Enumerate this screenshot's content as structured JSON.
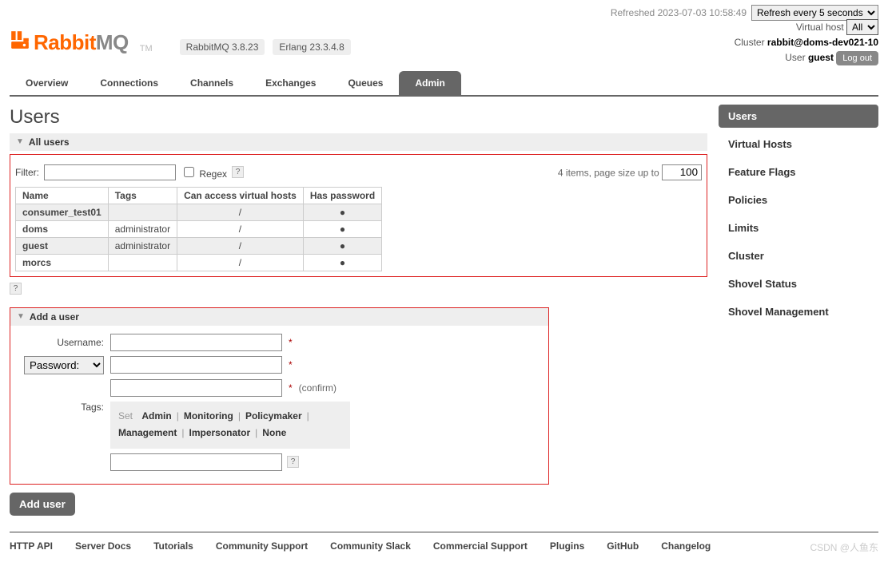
{
  "header": {
    "refreshed_label": "Refreshed",
    "refreshed_at": "2023-07-03 10:58:49",
    "refresh_select": "Refresh every 5 seconds",
    "logo_a": "Rabbit",
    "logo_b": "MQ",
    "tm": "TM",
    "badges": [
      "RabbitMQ 3.8.23",
      "Erlang 23.3.4.8"
    ],
    "vh_label": "Virtual host",
    "vh_value": "All",
    "cluster_label": "Cluster",
    "cluster_value": "rabbit@doms-dev021-10",
    "user_label": "User",
    "user_value": "guest",
    "logout": "Log out"
  },
  "nav": {
    "items": [
      "Overview",
      "Connections",
      "Channels",
      "Exchanges",
      "Queues",
      "Admin"
    ],
    "active": "Admin"
  },
  "page": {
    "title": "Users",
    "all_users_hdr": "All users",
    "filter_label": "Filter:",
    "regex_label": "Regex",
    "help_q": "?",
    "item_count_text": "4 items, page size up to",
    "page_size": "100",
    "cols": [
      "Name",
      "Tags",
      "Can access virtual hosts",
      "Has password"
    ],
    "rows": [
      {
        "name": "consumer_test01",
        "tags": "",
        "vhosts": "/",
        "pwd": "●"
      },
      {
        "name": "doms",
        "tags": "administrator",
        "vhosts": "/",
        "pwd": "●"
      },
      {
        "name": "guest",
        "tags": "administrator",
        "vhosts": "/",
        "pwd": "●"
      },
      {
        "name": "morcs",
        "tags": "",
        "vhosts": "/",
        "pwd": "●"
      }
    ],
    "add_hdr": "Add a user",
    "form": {
      "username_label": "Username:",
      "password_label": "Password:",
      "confirm_text": "(confirm)",
      "tags_label": "Tags:",
      "set_label": "Set",
      "tag_opts": [
        "Admin",
        "Monitoring",
        "Policymaker",
        "Management",
        "Impersonator",
        "None"
      ],
      "add_btn": "Add user"
    }
  },
  "sidebar": {
    "items": [
      "Users",
      "Virtual Hosts",
      "Feature Flags",
      "Policies",
      "Limits",
      "Cluster",
      "Shovel Status",
      "Shovel Management"
    ],
    "active": "Users"
  },
  "footer": {
    "links": [
      "HTTP API",
      "Server Docs",
      "Tutorials",
      "Community Support",
      "Community Slack",
      "Commercial Support",
      "Plugins",
      "GitHub",
      "Changelog"
    ],
    "watermark": "CSDN @人鱼东"
  }
}
